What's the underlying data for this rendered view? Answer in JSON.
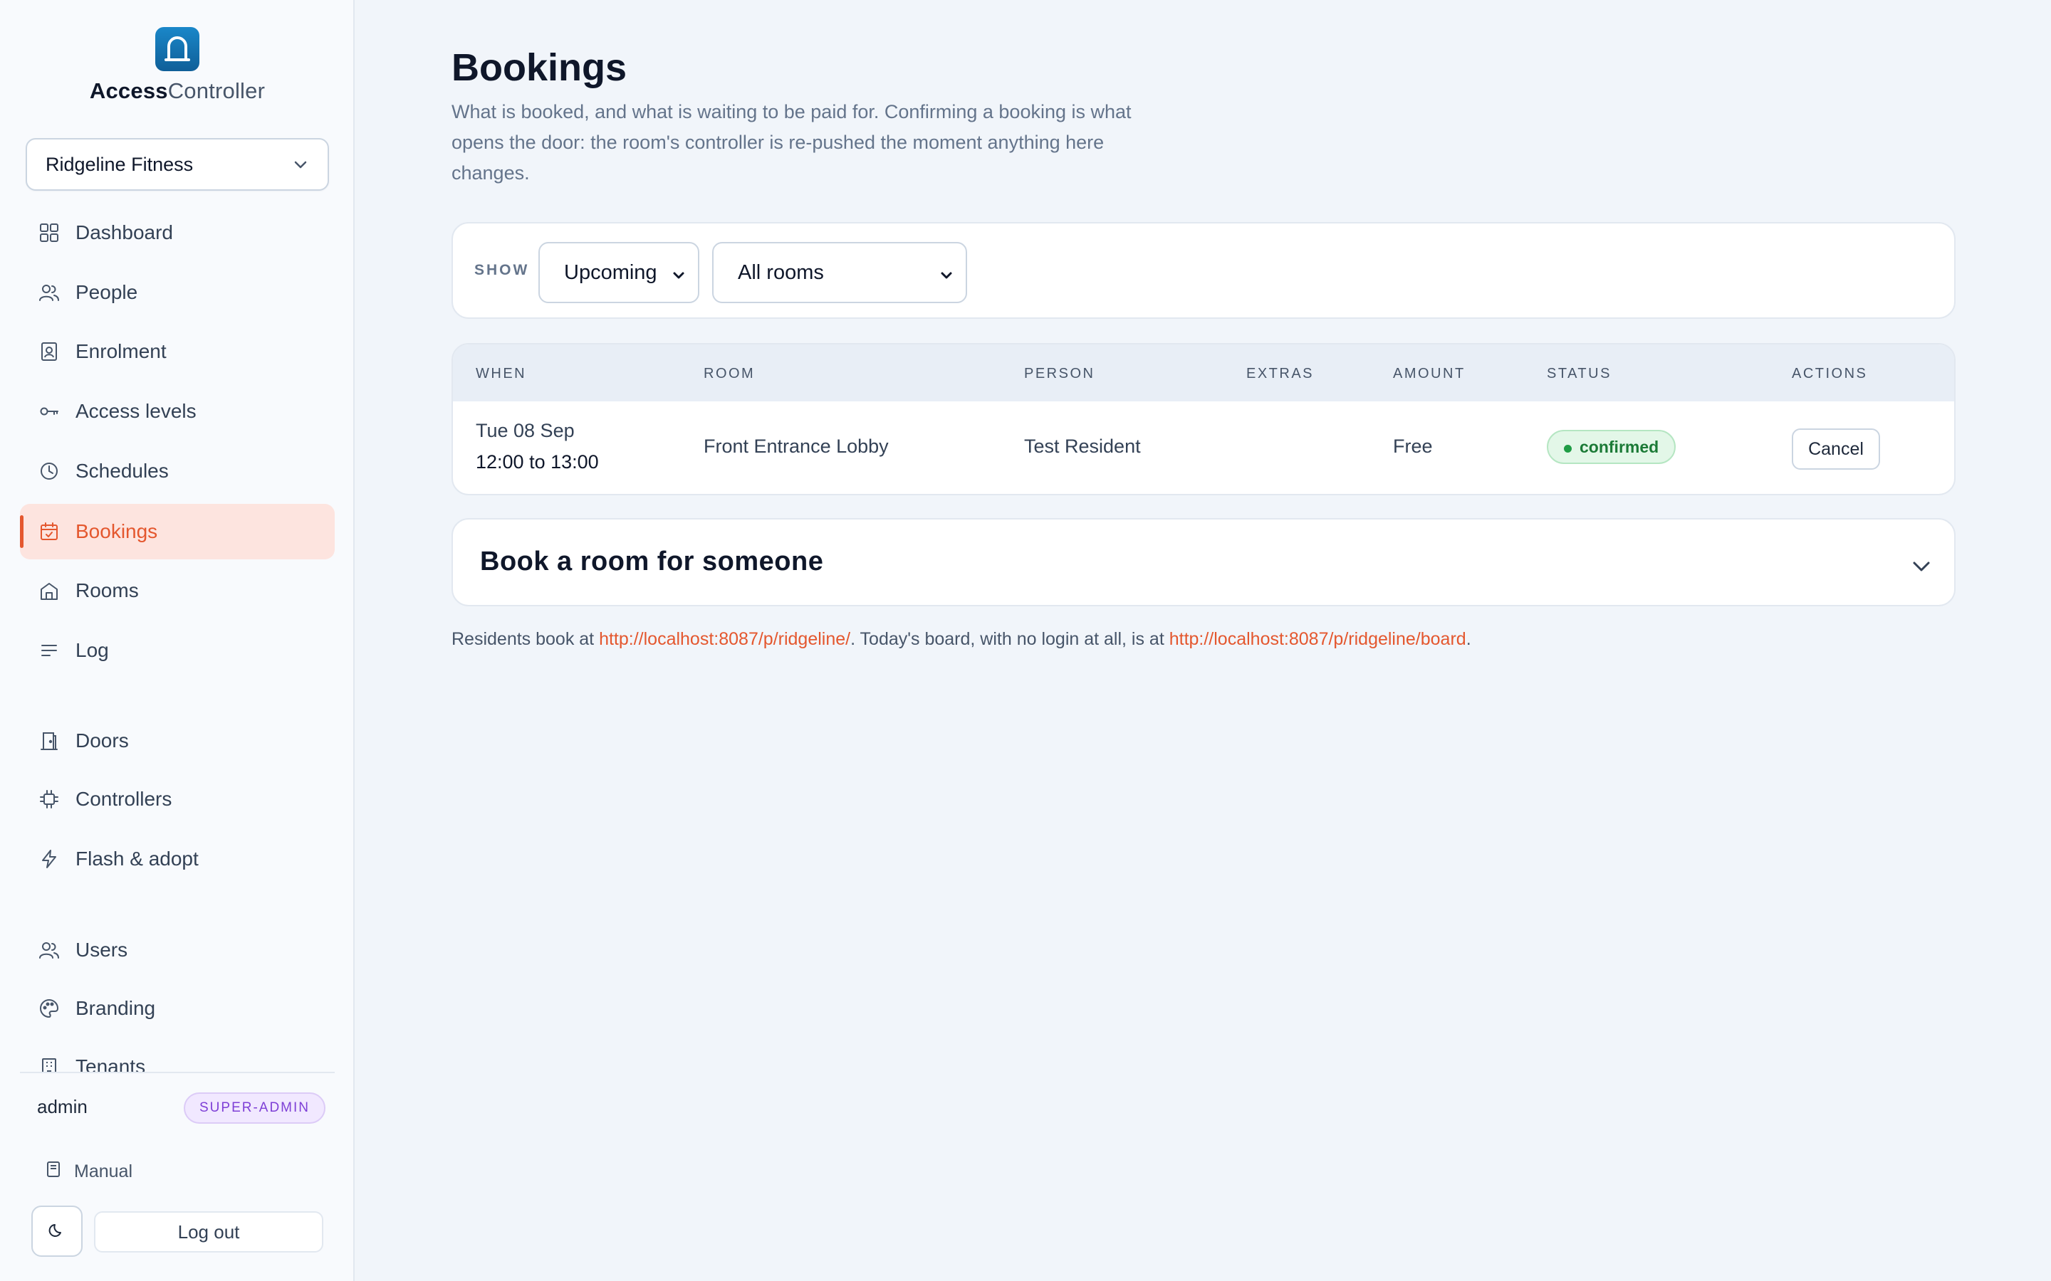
{
  "brand": {
    "name_bold": "Access",
    "name_rest": "Controller"
  },
  "tenant": {
    "selected": "Ridgeline Fitness"
  },
  "nav": [
    {
      "label": "Dashboard",
      "icon": "grid-icon",
      "active": false
    },
    {
      "label": "People",
      "icon": "people-icon",
      "active": false
    },
    {
      "label": "Enrolment",
      "icon": "id-card-icon",
      "active": false
    },
    {
      "label": "Access levels",
      "icon": "key-icon",
      "active": false
    },
    {
      "label": "Schedules",
      "icon": "clock-icon",
      "active": false
    },
    {
      "label": "Bookings",
      "icon": "calendar-icon",
      "active": true
    },
    {
      "label": "Rooms",
      "icon": "room-icon",
      "active": false
    },
    {
      "label": "Log",
      "icon": "list-icon",
      "active": false
    },
    {
      "label": "Doors",
      "icon": "door-icon",
      "active": false
    },
    {
      "label": "Controllers",
      "icon": "chip-icon",
      "active": false
    },
    {
      "label": "Flash & adopt",
      "icon": "bolt-icon",
      "active": false
    },
    {
      "label": "Users",
      "icon": "users-icon",
      "active": false
    },
    {
      "label": "Branding",
      "icon": "palette-icon",
      "active": false
    },
    {
      "label": "Tenants",
      "icon": "building-icon",
      "active": false
    }
  ],
  "user": {
    "name": "admin",
    "role": "SUPER-ADMIN"
  },
  "footer": {
    "manual": "Manual",
    "logout": "Log out"
  },
  "page": {
    "title": "Bookings",
    "description": "What is booked, and what is waiting to be paid for. Confirming a booking is what opens the door: the room's controller is re-pushed the moment anything here changes."
  },
  "filters": {
    "show_label": "SHOW",
    "period": "Upcoming",
    "room": "All rooms"
  },
  "table": {
    "headers": [
      "WHEN",
      "ROOM",
      "PERSON",
      "EXTRAS",
      "AMOUNT",
      "STATUS",
      "ACTIONS"
    ],
    "rows": [
      {
        "date": "Tue 08 Sep",
        "time": "12:00 to 13:00",
        "room": "Front Entrance Lobby",
        "person": "Test Resident",
        "extras": "",
        "amount": "Free",
        "status": "confirmed",
        "action": "Cancel"
      }
    ]
  },
  "book_section": {
    "title": "Book a room for someone"
  },
  "footnote": {
    "part1": "Residents book at ",
    "link1": "http://localhost:8087/p/ridgeline/",
    "part2": ". Today's board, with no login at all, is at ",
    "link2": "http://localhost:8087/p/ridgeline/board",
    "part3": "."
  },
  "colors": {
    "accent": "#e4572e",
    "active_bg": "#fde4df",
    "status_green": "#1b7a36",
    "logo_blue": "#1576b8"
  }
}
